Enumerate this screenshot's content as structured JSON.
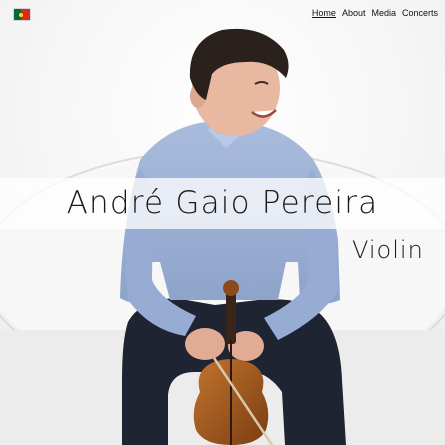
{
  "nav": {
    "flag_icon": "portugal-flag-icon",
    "items": [
      {
        "label": "Home",
        "active": true
      },
      {
        "label": "About",
        "active": false
      },
      {
        "label": "Media",
        "active": false
      },
      {
        "label": "Concerts",
        "active": false
      }
    ]
  },
  "hero": {
    "name": "André Gaio Pereira",
    "instrument": "Violin"
  },
  "colors": {
    "shirt": "#9fb3d6",
    "trousers": "#1f2433",
    "violin": "#a55a1f",
    "hair": "#2a211c",
    "skin": "#e8b9a0"
  }
}
